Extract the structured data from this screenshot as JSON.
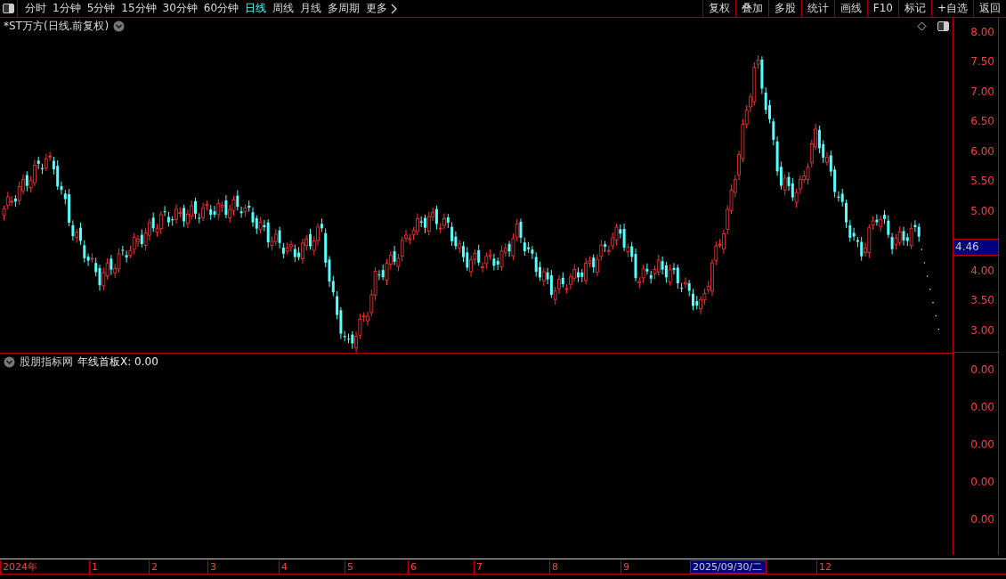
{
  "toolbar": {
    "periods": [
      {
        "label": "分时",
        "selected": false
      },
      {
        "label": "1分钟",
        "selected": false
      },
      {
        "label": "5分钟",
        "selected": false
      },
      {
        "label": "15分钟",
        "selected": false
      },
      {
        "label": "30分钟",
        "selected": false
      },
      {
        "label": "60分钟",
        "selected": false
      },
      {
        "label": "日线",
        "selected": true
      },
      {
        "label": "周线",
        "selected": false
      },
      {
        "label": "月线",
        "selected": false
      },
      {
        "label": "多周期",
        "selected": false
      },
      {
        "label": "更多",
        "selected": false
      }
    ],
    "buttons": [
      "复权",
      "叠加",
      "多股",
      "统计",
      "画线",
      "F10",
      "标记",
      "+自选",
      "返回"
    ]
  },
  "chart": {
    "title": "*ST万方(日线.前复权)",
    "y_ticks": [
      "8.00",
      "7.50",
      "7.00",
      "6.50",
      "6.00",
      "5.50",
      "5.00",
      "4.00",
      "3.50",
      "3.00"
    ],
    "price_label": "4.46"
  },
  "indicator": {
    "source": "股朋指标网",
    "name": "年线首板X: 0.00",
    "y_ticks": [
      "0.00",
      "0.00",
      "0.00",
      "0.00",
      "0.00"
    ]
  },
  "time_axis": {
    "labels": [
      "2024年",
      "1",
      "2",
      "3",
      "4",
      "5",
      "6",
      "7",
      "8",
      "9"
    ],
    "cursor_date": "2025/09/30/二",
    "after_cursor": [
      "12"
    ]
  }
}
